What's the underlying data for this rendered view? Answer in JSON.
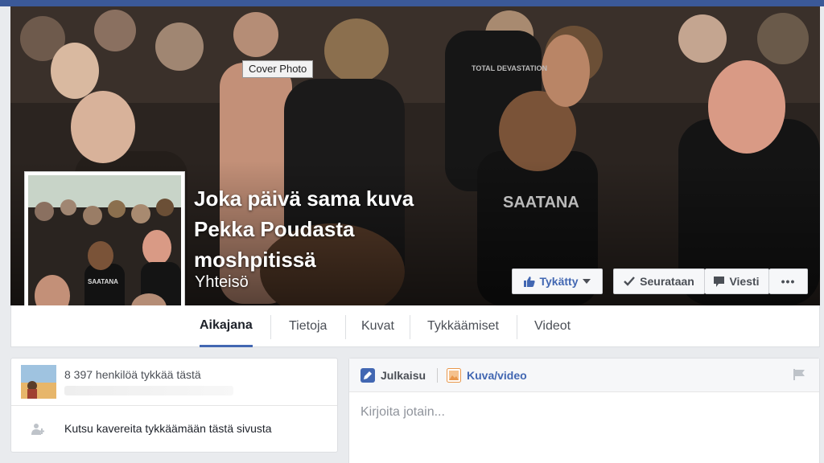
{
  "cover": {
    "tooltip": "Cover Photo",
    "title": "Joka päivä sama kuva Pekka Poudasta moshpitissä",
    "category": "Yhteisö"
  },
  "actions": {
    "like_label": "Tykätty",
    "follow_label": "Seurataan",
    "message_label": "Viesti",
    "more_label": "•••"
  },
  "tabs": [
    {
      "label": "Aikajana",
      "active": true
    },
    {
      "label": "Tietoja",
      "active": false
    },
    {
      "label": "Kuvat",
      "active": false
    },
    {
      "label": "Tykkäämiset",
      "active": false
    },
    {
      "label": "Videot",
      "active": false
    }
  ],
  "left_panel": {
    "likes_text": "8 397 henkilöä tykkää tästä",
    "invite_text": "Kutsu kavereita tykkäämään tästä sivusta"
  },
  "composer": {
    "tab_post": "Julkaisu",
    "tab_photo": "Kuva/video",
    "placeholder": "Kirjoita jotain..."
  },
  "colors": {
    "brand": "#3b5998",
    "accent": "#4267b2"
  }
}
